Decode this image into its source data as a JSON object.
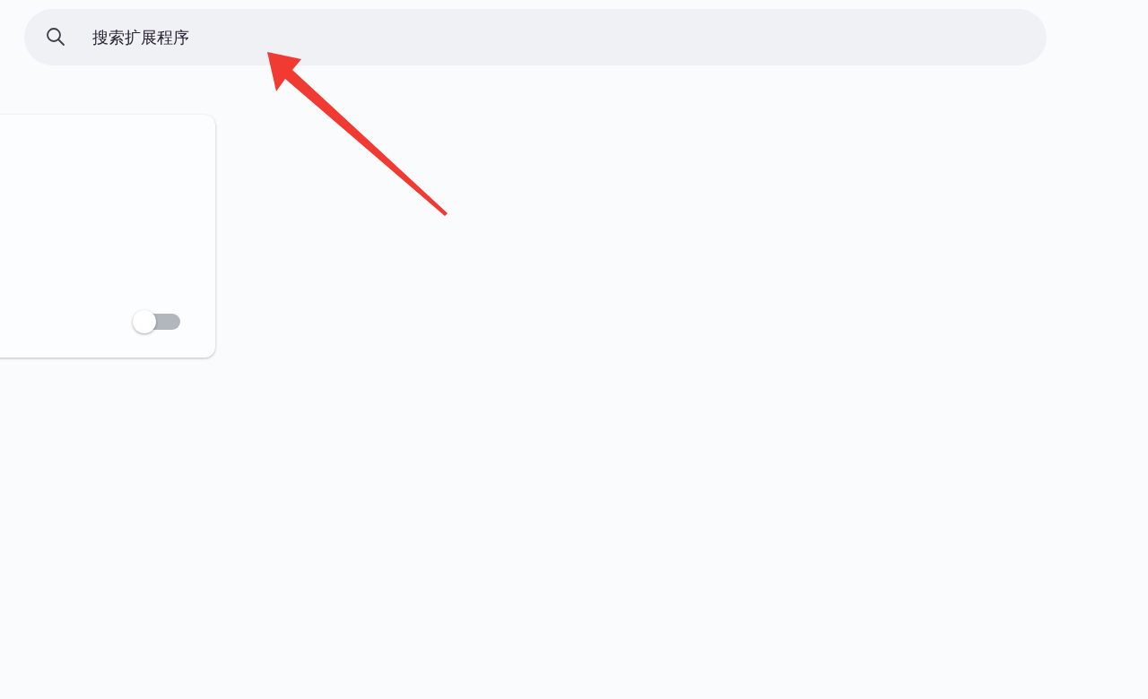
{
  "search": {
    "placeholder": "搜索扩展程序"
  },
  "extension_card": {
    "toggle": {
      "on": false
    }
  }
}
